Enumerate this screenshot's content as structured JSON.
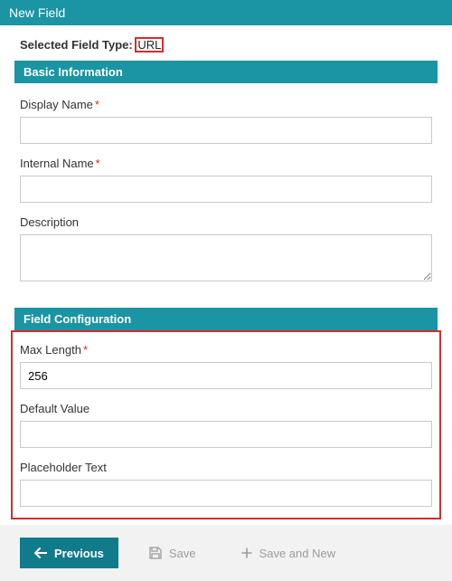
{
  "header": {
    "title": "New Field"
  },
  "selected": {
    "label": "Selected Field Type:",
    "value": "URL"
  },
  "basic": {
    "section_title": "Basic Information",
    "display_name": {
      "label": "Display Name",
      "required": true,
      "value": ""
    },
    "internal_name": {
      "label": "Internal Name",
      "required": true,
      "value": ""
    },
    "description": {
      "label": "Description",
      "value": ""
    }
  },
  "config": {
    "section_title": "Field Configuration",
    "max_length": {
      "label": "Max Length",
      "required": true,
      "value": "256"
    },
    "default_value": {
      "label": "Default Value",
      "value": ""
    },
    "placeholder_text": {
      "label": "Placeholder Text",
      "value": ""
    }
  },
  "footer": {
    "previous": "Previous",
    "save": "Save",
    "save_and_new": "Save and New"
  }
}
